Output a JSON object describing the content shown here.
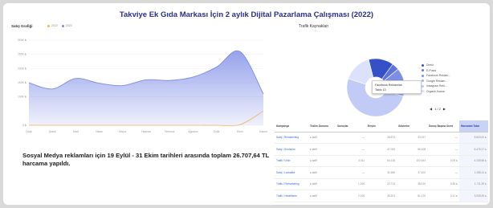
{
  "title": "Takviye Ek Gıda Markası İçin 2 aylık Dijital Pazarlama Çalışması (2022)",
  "sales_chart": {
    "label": "Satış Grafiği",
    "legend": [
      "2022",
      "2023"
    ],
    "y_ticks": [
      "300K ₺",
      "250K ₺",
      "200K ₺",
      "150K ₺",
      "100K ₺",
      "0 ₺"
    ],
    "x_ticks": [
      "Ocak",
      "Şubat",
      "Mart",
      "Nisan",
      "Mayıs",
      "Haziran",
      "Temmuz",
      "Ağustos",
      "Eylül",
      "Ekim",
      "Kasım"
    ],
    "colors": {
      "series_2022": "#7b8ae6",
      "series_2023": "#f3b25f"
    }
  },
  "chart_data": {
    "type": "area",
    "categories": [
      "Ocak",
      "Şubat",
      "Mart",
      "Nisan",
      "Mayıs",
      "Haziran",
      "Temmuz",
      "Ağustos",
      "Eylül",
      "Ekim",
      "Kasım"
    ],
    "series": [
      {
        "name": "2022",
        "values": [
          150000,
          128000,
          165000,
          148000,
          140000,
          160000,
          158000,
          170000,
          205000,
          260000,
          110000
        ]
      },
      {
        "name": "2023",
        "values": [
          0,
          0,
          0,
          0,
          0,
          0,
          0,
          0,
          0,
          2000,
          50000
        ]
      }
    ],
    "ylim": [
      0,
      300000
    ]
  },
  "traffic": {
    "label": "Trafik Kaynakları",
    "legend": [
      "Direkt",
      "E-Posta",
      "Facebook Reklam...",
      "Google Reklam...",
      "Instagram Rekl...",
      "Organik Arama"
    ],
    "slices": [
      {
        "label": "Direkt",
        "value": 14,
        "color": "#3651c8"
      },
      {
        "label": "E-Posta",
        "value": 4,
        "color": "#5f73d8"
      },
      {
        "label": "Facebook Reklam...",
        "value": 10,
        "color": "#7d8fe3"
      },
      {
        "label": "Google Reklam...",
        "value": 6,
        "color": "#a3b0ee"
      },
      {
        "label": "Instagram Rekl...",
        "value": 50,
        "color": "#c1cbf6"
      },
      {
        "label": "Organik Arama",
        "value": 16,
        "color": "#dce2fb"
      }
    ],
    "tooltip_title": "Facebook Reklamları",
    "tooltip_value": "Tablo 10",
    "pager": "◀ 1/2 ▶"
  },
  "note": "Sosyal Medya reklamları için 19 Eylül - 31 Ekim tarihleri arasında toplam 26.707,64 TL harcama yapıldı.",
  "table": {
    "headers": [
      "Kampanya",
      "Teslim Durumu",
      "Sonuçlar",
      "Erişim",
      "Gösterim",
      "Sonuç Başına Ücret",
      "Harcanan Tutar"
    ],
    "rows": [
      [
        "Satış / Remarketing",
        "● aktif",
        "—",
        "28.574",
        "33.197",
        "—",
        "8.820,00 ₺"
      ],
      [
        "Satış / Dönüşüm",
        "● aktif",
        "—",
        "47.063",
        "56.108",
        "—",
        "6.475,17 ₺"
      ],
      [
        "Trafik / Ürün",
        "● aktif",
        "3.411",
        "64.126",
        "102.444",
        "0,09 ₺",
        "4.230,58 ₺"
      ],
      [
        "Satış / Lookalike",
        "● aktif",
        "—",
        "31.556",
        "37.402",
        "—",
        "1.935,11 ₺"
      ],
      [
        "Trafik / Remarketing",
        "● aktif",
        "1.209",
        "22.714",
        "38.410",
        "0,45 ₺",
        "1.711,39 ₺"
      ],
      [
        "Trafik / Hedefleme",
        "● aktif",
        "2.108",
        "38.201",
        "61.170",
        "0,41 ₺",
        "3.535,39 ₺"
      ]
    ]
  }
}
